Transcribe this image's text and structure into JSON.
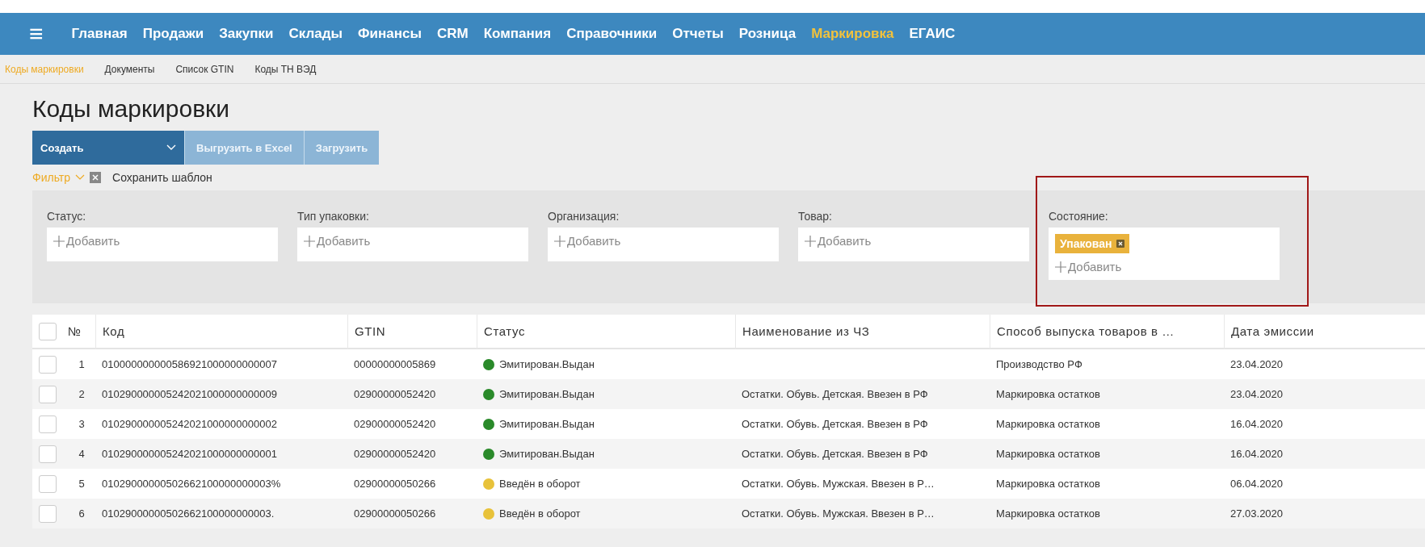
{
  "nav": {
    "menu_icon": "≡",
    "items": [
      {
        "label": "Главная",
        "selected": false
      },
      {
        "label": "Продажи",
        "selected": false
      },
      {
        "label": "Закупки",
        "selected": false
      },
      {
        "label": "Склады",
        "selected": false
      },
      {
        "label": "Финансы",
        "selected": false
      },
      {
        "label": "CRM",
        "selected": false
      },
      {
        "label": "Компания",
        "selected": false
      },
      {
        "label": "Справочники",
        "selected": false
      },
      {
        "label": "Отчеты",
        "selected": false
      },
      {
        "label": "Розница",
        "selected": false
      },
      {
        "label": "Маркировка",
        "selected": true
      },
      {
        "label": "ЕГАИС",
        "selected": false
      }
    ]
  },
  "subnav": [
    {
      "label": "Коды маркировки",
      "selected": true
    },
    {
      "label": "Документы",
      "selected": false
    },
    {
      "label": "Список GTIN",
      "selected": false
    },
    {
      "label": "Коды ТН ВЭД",
      "selected": false
    }
  ],
  "page_title": "Коды маркировки",
  "toolbar": {
    "create": "Создать",
    "buttons": [
      "Выгрузить в Excel",
      "Загрузить"
    ]
  },
  "filter_bar": {
    "filter": "Фильтр",
    "save_template": "Сохранить шаблон"
  },
  "filters": [
    {
      "label": "Статус:",
      "add": "Добавить",
      "highlighted": false
    },
    {
      "label": "Тип упаковки:",
      "add": "Добавить",
      "highlighted": false
    },
    {
      "label": "Организация:",
      "add": "Добавить",
      "highlighted": false
    },
    {
      "label": "Товар:",
      "add": "Добавить",
      "highlighted": false
    },
    {
      "label": "Состояние:",
      "tags": [
        "Упакован"
      ],
      "add": "Добавить",
      "highlighted": true
    }
  ],
  "table": {
    "select_all_checked": false,
    "columns": [
      "№",
      "Код",
      "GTIN",
      "Статус",
      "Наименование из ЧЗ",
      "Способ выпуска товаров в …",
      "Дата эмиссии"
    ],
    "rows": [
      {
        "checked": false,
        "n": "1",
        "code": "010000000000586921000000000007",
        "gtin": "00000000005869",
        "status": "Эмитирован.Выдан",
        "color": "#2a8a2a",
        "method": "Производство РФ",
        "date": "23.04.2020"
      },
      {
        "checked": false,
        "n": "2",
        "code": "010290000005242021000000000009",
        "gtin": "02900000052420",
        "status": "Эмитирован.Выдан",
        "color": "#2a8a2a",
        "name": "Остатки. Обувь. Детская. Ввезен в РФ",
        "method": "Маркировка остатков",
        "date": "23.04.2020"
      },
      {
        "checked": false,
        "n": "3",
        "code": "010290000005242021000000000002",
        "gtin": "02900000052420",
        "status": "Эмитирован.Выдан",
        "color": "#2a8a2a",
        "name": "Остатки. Обувь. Детская. Ввезен в РФ",
        "method": "Маркировка остатков",
        "date": "16.04.2020"
      },
      {
        "checked": false,
        "n": "4",
        "code": "010290000005242021000000000001",
        "gtin": "02900000052420",
        "status": "Эмитирован.Выдан",
        "color": "#2a8a2a",
        "name": "Остатки. Обувь. Детская. Ввезен в РФ",
        "method": "Маркировка остатков",
        "date": "16.04.2020"
      },
      {
        "checked": false,
        "n": "5",
        "code": "01029000000502662100000000003%",
        "gtin": "02900000050266",
        "status": "Введён в оборот",
        "color": "#e8c23a",
        "name": "Остатки. Обувь. Мужская. Ввезен в Р…",
        "method": "Маркировка остатков",
        "date": "06.04.2020"
      },
      {
        "checked": false,
        "n": "6",
        "code": "01029000000502662100000000003.",
        "gtin": "02900000050266",
        "status": "Введён в оборот",
        "color": "#e8c23a",
        "name": "Остатки. Обувь. Мужская. Ввезен в Р…",
        "method": "Маркировка остатков",
        "date": "27.03.2020"
      }
    ]
  }
}
